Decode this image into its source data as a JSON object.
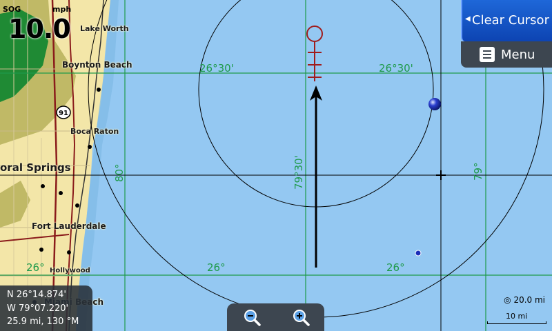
{
  "sog": {
    "label": "SOG",
    "unit": "mph",
    "value": "10.0"
  },
  "buttons": {
    "clear_cursor": "Clear Cursor",
    "menu": "Menu"
  },
  "places": {
    "lake_worth": "Lake Worth",
    "boynton_beach": "Boynton Beach",
    "boca_raton": "Boca Raton",
    "coral_springs": "oral Springs",
    "fort_lauderdale": "Fort Lauderdale",
    "hollywood": "Hollywood",
    "miami_beach": "Miami Beach"
  },
  "highway_shield": "91",
  "grid": {
    "lat_north_left": "26°30'",
    "lat_north_right": "26°30'",
    "lat_south_left": "26°",
    "lat_south_mid": "26°",
    "lat_south_right": "26°",
    "lon_west": "80°",
    "lon_mid": "79°30'",
    "lon_east": "79°"
  },
  "position": {
    "lat": "N  26°14.874'",
    "lon": "W  79°07.220'",
    "range_bearing": "25.9 mi, 130 °M"
  },
  "scale": {
    "range": "20.0 mi",
    "bar_length": "10 mi"
  },
  "icons": [
    "chevron-left-icon",
    "menu-icon",
    "zoom-out-icon",
    "zoom-in-icon",
    "range-ring-icon",
    "cursor-crosshair-icon",
    "vessel-arrow-icon",
    "waypoint-marker-icon"
  ],
  "colors": {
    "water": "#94c8f2",
    "land": "#f3e6a8",
    "park": "#1f8a34",
    "grid": "#1e9a4a",
    "button_blue": "#1558c8",
    "panel": "#3d4650"
  }
}
